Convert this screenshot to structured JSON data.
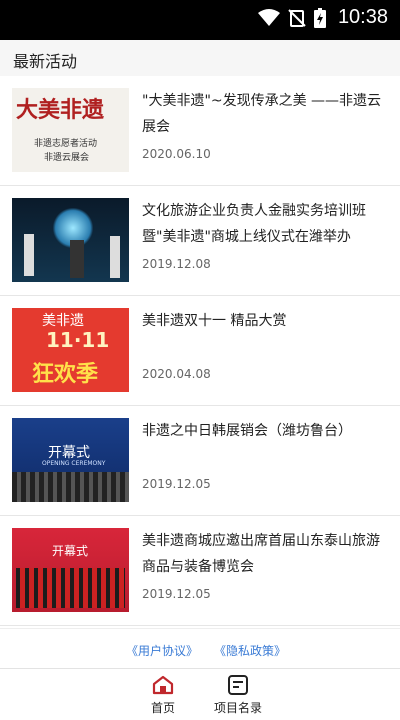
{
  "status": {
    "time": "10:38"
  },
  "section": {
    "title": "最新活动"
  },
  "items": [
    {
      "title": "\"大美非遗\"~发现传承之美 ——非遗云展会",
      "date": "2020.06.10",
      "thumb_text_1": "大美非遗",
      "thumb_text_2": "非遗志愿者活动",
      "thumb_text_3": "非遗云展会"
    },
    {
      "title": "文化旅游企业负责人金融实务培训班暨\"美非遗\"商城上线仪式在潍举办",
      "date": "2019.12.08"
    },
    {
      "title": "美非遗双十一 精品大赏",
      "date": "2020.04.08",
      "thumb_text_1": "美非遗",
      "thumb_text_2": "11·11",
      "thumb_text_3": "狂欢季"
    },
    {
      "title": "非遗之中日韩展销会（潍坊鲁台）",
      "date": "2019.12.05",
      "thumb_text_1": "开幕式",
      "thumb_text_2": "OPENING CEREMONY"
    },
    {
      "title": "美非遗商城应邀出席首届山东泰山旅游商品与装备博览会",
      "date": "2019.12.05",
      "thumb_text_1": "开幕式"
    }
  ],
  "footer": {
    "user_agreement": "《用户协议》",
    "privacy_policy": "《隐私政策》"
  },
  "tabs": [
    {
      "label": "首页"
    },
    {
      "label": "项目名录"
    }
  ],
  "colors": {
    "accent": "#c0282d",
    "link": "#3a7bd5"
  }
}
